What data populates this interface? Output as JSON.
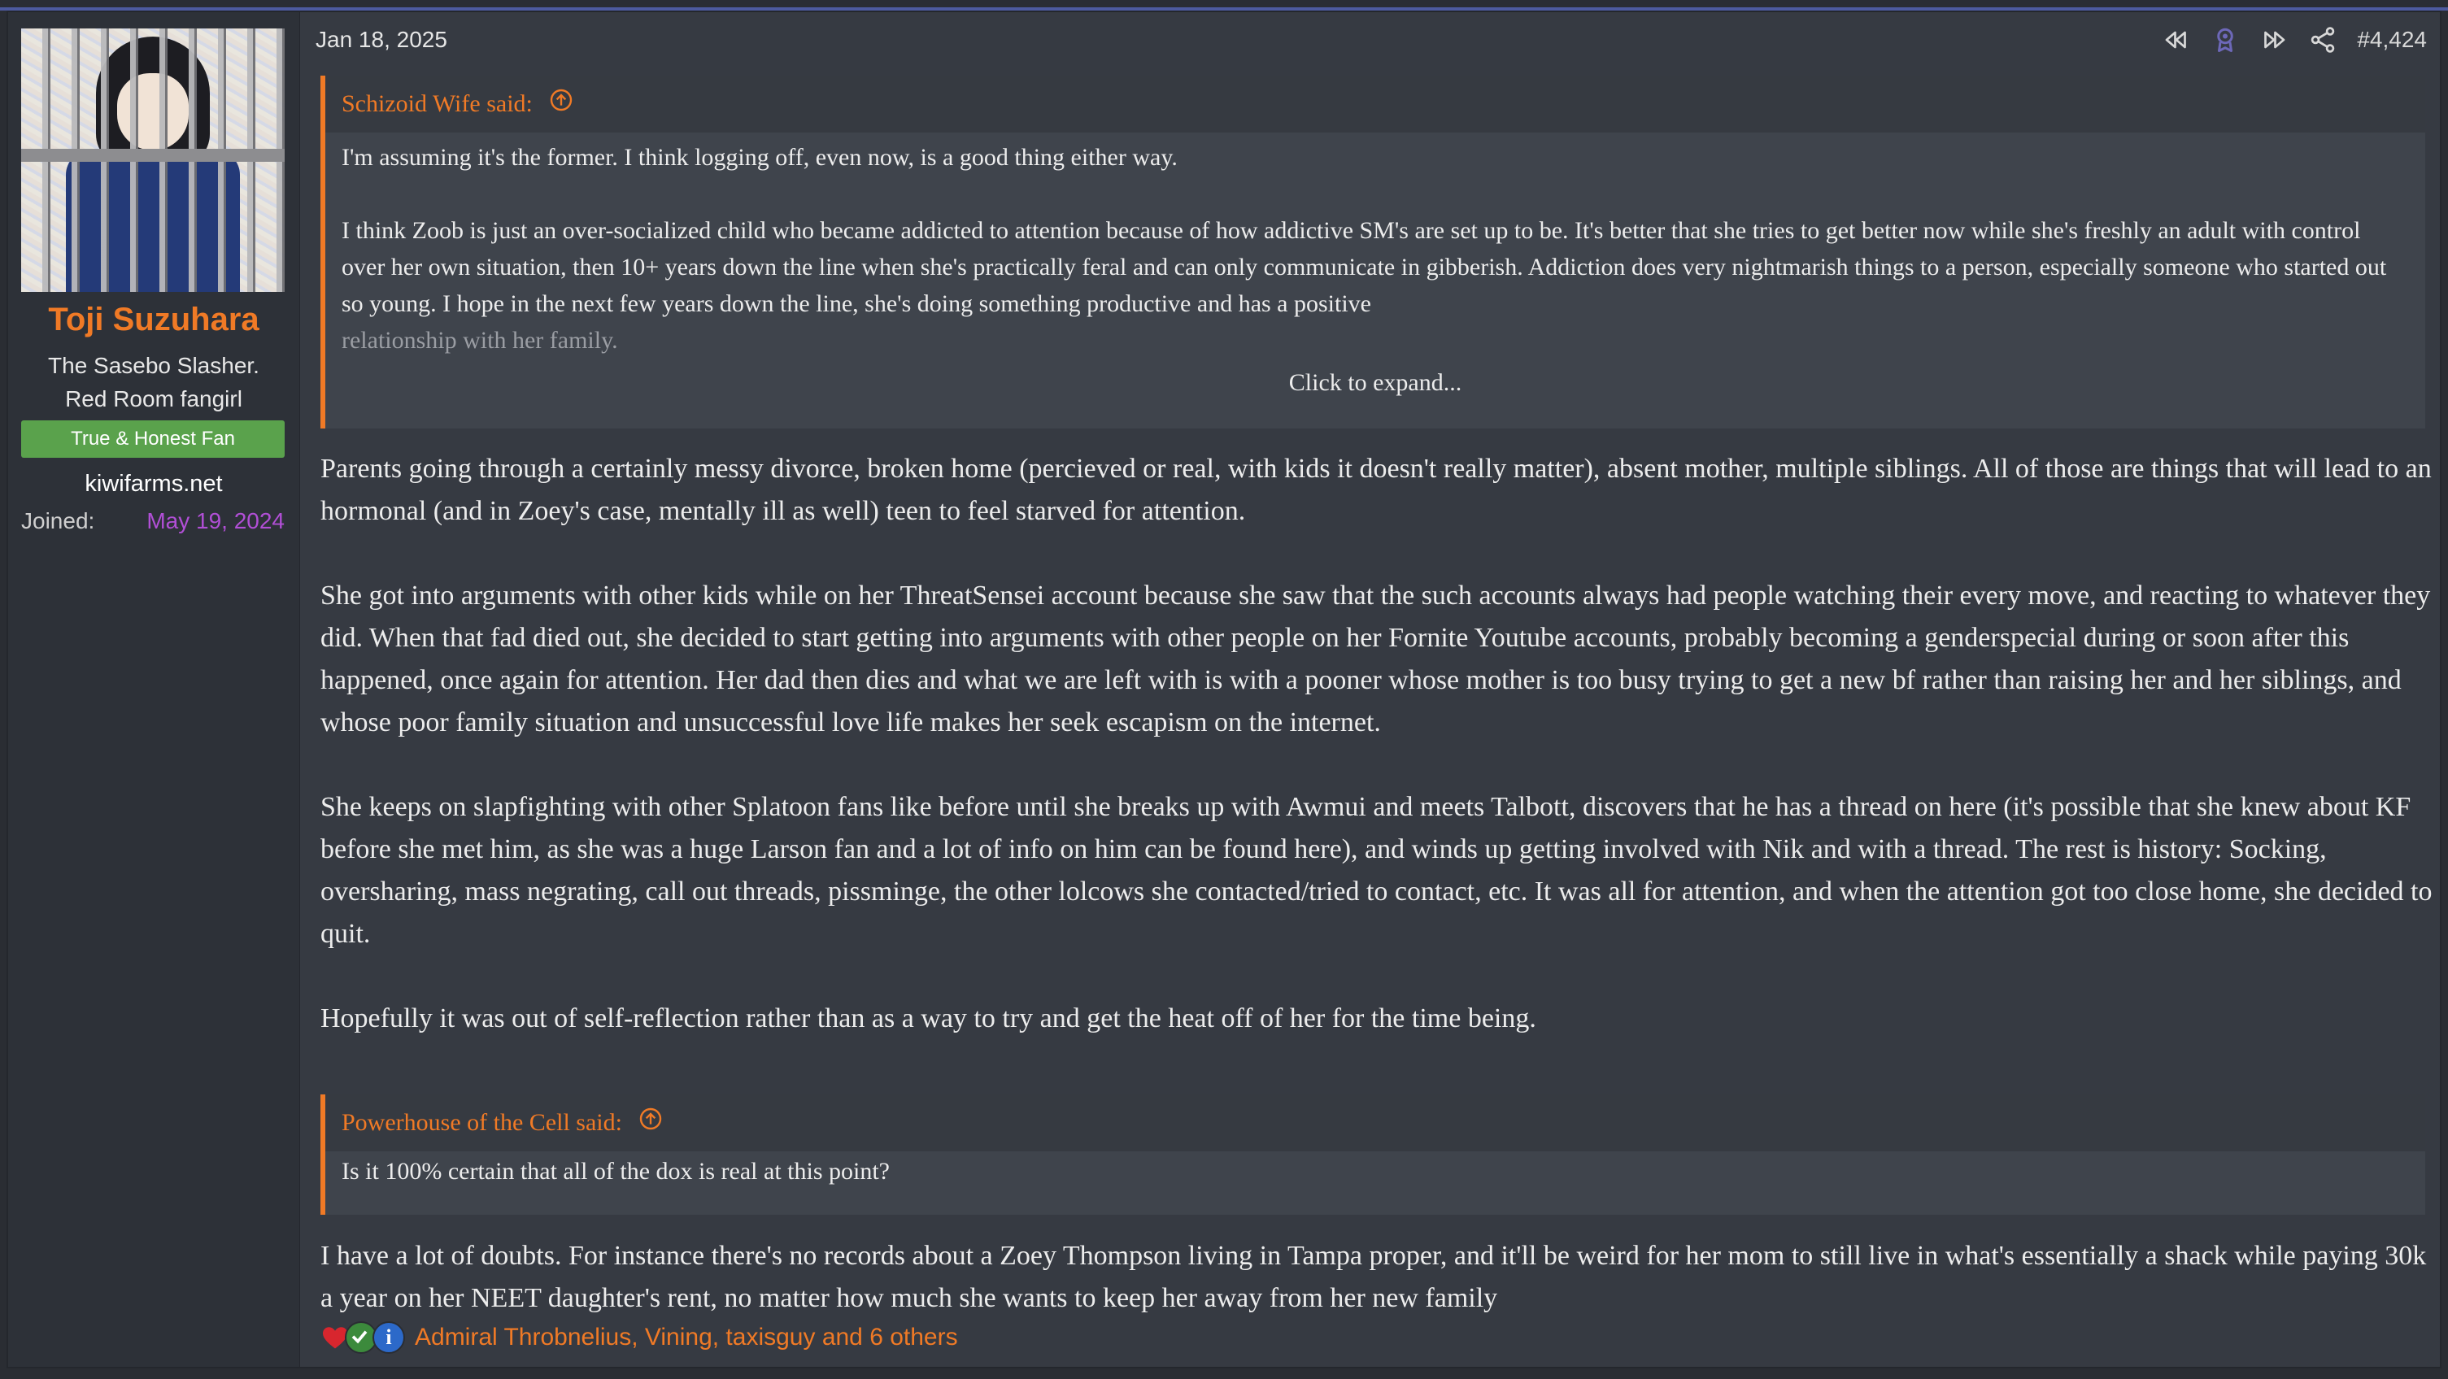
{
  "user": {
    "name": "Toji Suzuhara",
    "title_line1": "The Sasebo Slasher.",
    "title_line2": "Red Room fangirl",
    "banner": "True & Honest Fan",
    "site": "kiwifarms.net",
    "joined_label": "Joined:",
    "joined_date": "May 19, 2024"
  },
  "post": {
    "date": "Jan 18, 2025",
    "number": "#4,424",
    "icons": [
      "rewind-icon",
      "badge-icon",
      "forward-icon",
      "share-icon"
    ]
  },
  "quote1": {
    "author": "Schizoid Wife said:",
    "p1": "I'm assuming it's the former. I think logging off, even now, is a good thing either way.",
    "p2": "I think Zoob is just an over-socialized child who became addicted to attention because of how addictive SM's are set up to be. It's better that she tries to get better now while she's freshly an adult with control over her own situation, then 10+ years down the line when she's practically feral and can only communicate in gibberish. Addiction does very nightmarish things to a person, especially someone who started out so young. I hope in the next few years down the line, she's doing something productive and has a positive",
    "p2_faded": "relationship with her family.",
    "expand": "Click to expand..."
  },
  "body1": {
    "p1": "Parents going through a certainly messy divorce, broken home (percieved or real, with kids it doesn't really matter), absent mother, multiple siblings. All of those are things that will lead to an hormonal (and in Zoey's case, mentally ill as well) teen to feel starved for attention.",
    "p2": "She got into arguments with other kids while on her ThreatSensei account because she saw that the such accounts always had people watching their every move, and reacting to whatever they did. When that fad died out, she decided to start getting into arguments with other people on her Fornite Youtube accounts, probably becoming a genderspecial during or soon after this happened, once again for attention. Her dad then dies and what we are left with is with a pooner whose mother is too busy trying to get a new bf rather than raising her and her siblings, and whose poor family situation and unsuccessful love life makes her seek escapism on the internet.",
    "p3": "She keeps on slapfighting with other Splatoon fans like before until she breaks up with Awmui and meets Talbott, discovers that he has a thread on here (it's possible that she knew about KF before she met him, as she was a huge Larson fan and a lot of info on him can be found here), and winds up getting involved with Nik and with a thread. The rest is history: Socking, oversharing, mass negrating, call out threads, pissminge, the other lolcows she contacted/tried to contact, etc. It was all for attention, and when the attention got too close home, she decided to quit.",
    "p4": "Hopefully it was out of self-reflection rather than as a way to try and get the heat off of her for the time being."
  },
  "quote2": {
    "author": "Powerhouse of the Cell said:",
    "text": "Is it 100% certain that all of the dox is real at this point?"
  },
  "body2": {
    "text": "I have a lot of doubts. For instance there's no records about a Zoey Thompson living in Tampa proper, and it'll be weird for her mom to still live in what's essentially a shack while paying 30k a year on her NEET daughter's rent, no matter how much she wants to keep her away from her new family"
  },
  "reactions": {
    "icons": [
      "heart-icon",
      "check-icon",
      "info-icon"
    ],
    "names": "Admiral Throbnelius, Vining, taxisguy and 6 others"
  },
  "colors": {
    "accent": "#f07a26",
    "banner": "#5aa24c",
    "joined_date": "#b14fd6",
    "top_line": "#4d5a9e"
  }
}
